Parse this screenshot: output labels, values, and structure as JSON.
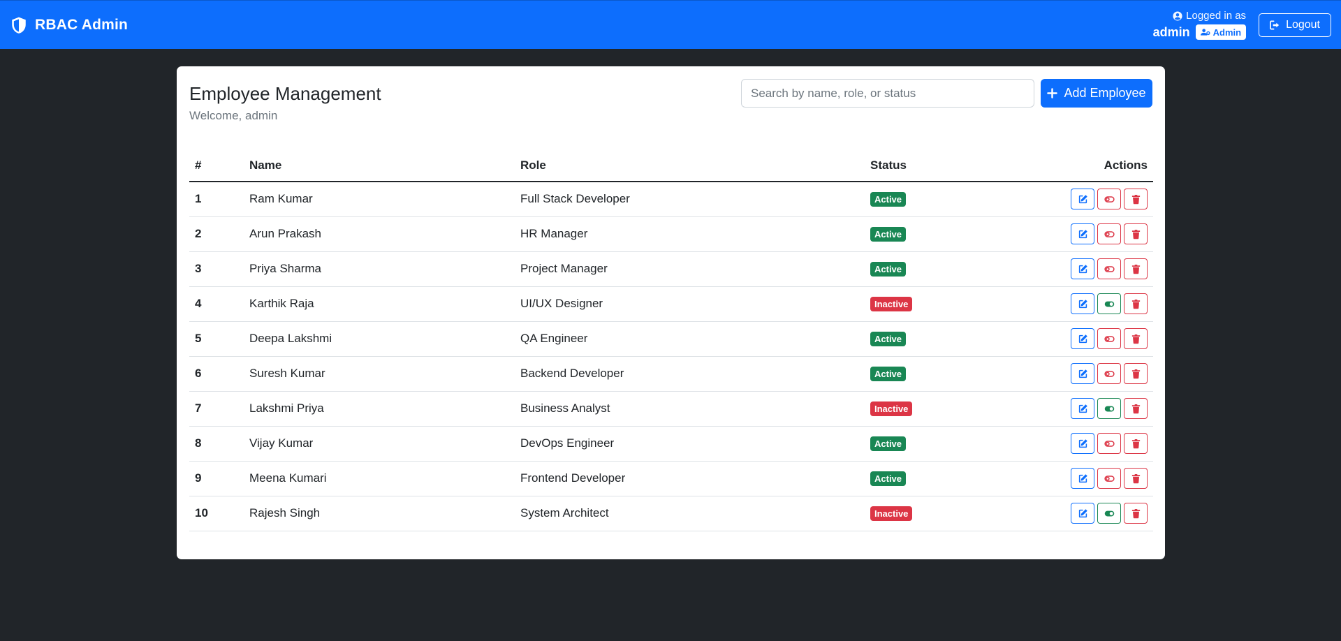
{
  "navbar": {
    "brand": "RBAC Admin",
    "logged_in_label": "Logged in as",
    "username": "admin",
    "role_badge": "Admin",
    "logout_label": "Logout"
  },
  "page": {
    "title": "Employee Management",
    "welcome": "Welcome, admin",
    "search_placeholder": "Search by name, role, or status",
    "add_button": "Add Employee"
  },
  "table": {
    "headers": {
      "num": "#",
      "name": "Name",
      "role": "Role",
      "status": "Status",
      "actions": "Actions"
    },
    "rows": [
      {
        "num": "1",
        "name": "Ram Kumar",
        "role": "Full Stack Developer",
        "status": "Active"
      },
      {
        "num": "2",
        "name": "Arun Prakash",
        "role": "HR Manager",
        "status": "Active"
      },
      {
        "num": "3",
        "name": "Priya Sharma",
        "role": "Project Manager",
        "status": "Active"
      },
      {
        "num": "4",
        "name": "Karthik Raja",
        "role": "UI/UX Designer",
        "status": "Inactive"
      },
      {
        "num": "5",
        "name": "Deepa Lakshmi",
        "role": "QA Engineer",
        "status": "Active"
      },
      {
        "num": "6",
        "name": "Suresh Kumar",
        "role": "Backend Developer",
        "status": "Active"
      },
      {
        "num": "7",
        "name": "Lakshmi Priya",
        "role": "Business Analyst",
        "status": "Inactive"
      },
      {
        "num": "8",
        "name": "Vijay Kumar",
        "role": "DevOps Engineer",
        "status": "Active"
      },
      {
        "num": "9",
        "name": "Meena Kumari",
        "role": "Frontend Developer",
        "status": "Active"
      },
      {
        "num": "10",
        "name": "Rajesh Singh",
        "role": "System Architect",
        "status": "Inactive"
      }
    ]
  },
  "colors": {
    "primary": "#0d6efd",
    "success": "#198754",
    "danger": "#dc3545",
    "background": "#212529"
  },
  "icons": {
    "brand": "shield-halved-icon",
    "user": "user-circle-icon",
    "role": "user-gear-icon",
    "logout": "sign-out-icon",
    "add": "plus-icon",
    "edit": "edit-icon",
    "toggle_off": "toggle-off-icon",
    "toggle_on": "toggle-on-icon",
    "delete": "trash-icon"
  }
}
